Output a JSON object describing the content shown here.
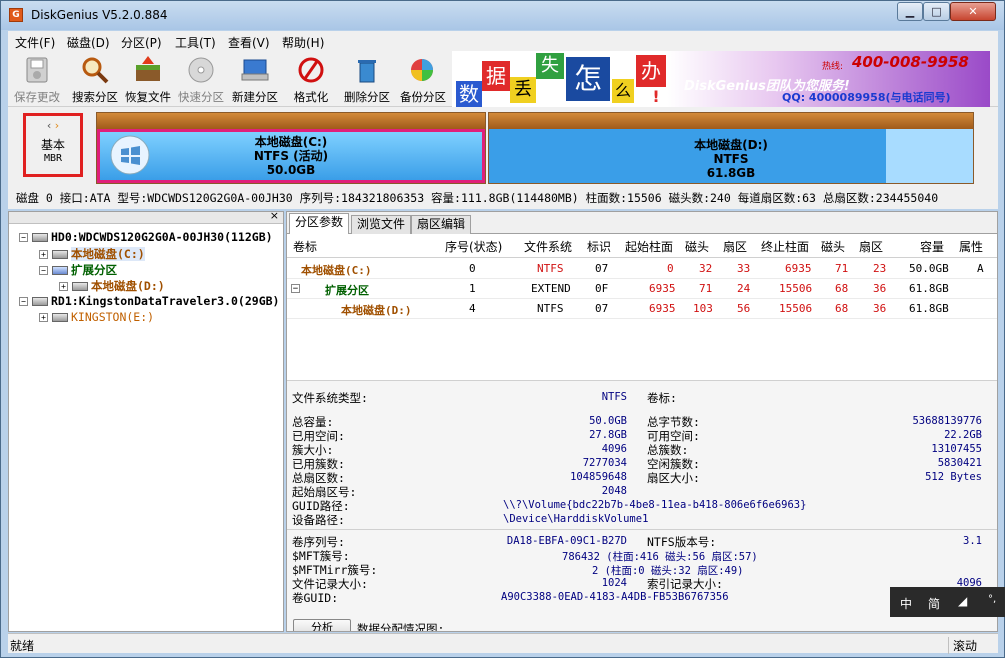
{
  "window": {
    "title": "DiskGenius V5.2.0.884",
    "app_icon": "G"
  },
  "window_buttons": {
    "minimize": "▁",
    "maximize": "□",
    "close": "✕"
  },
  "menu": [
    "文件(F)",
    "磁盘(D)",
    "分区(P)",
    "工具(T)",
    "查看(V)",
    "帮助(H)"
  ],
  "toolbar": [
    {
      "label": "保存更改",
      "icon": "save-icon",
      "enabled": false
    },
    {
      "label": "搜索分区",
      "icon": "magnifier-icon",
      "enabled": true
    },
    {
      "label": "恢复文件",
      "icon": "recover-files-icon",
      "enabled": true
    },
    {
      "label": "快速分区",
      "icon": "quick-partition-icon",
      "enabled": false
    },
    {
      "label": "新建分区",
      "icon": "new-partition-icon",
      "enabled": true
    },
    {
      "label": "格式化",
      "icon": "format-icon",
      "enabled": true
    },
    {
      "label": "删除分区",
      "icon": "delete-partition-icon",
      "enabled": true
    },
    {
      "label": "备份分区",
      "icon": "backup-partition-icon",
      "enabled": true
    }
  ],
  "banner": {
    "chars": [
      "数",
      "据",
      "丢",
      "失",
      "怎",
      "么",
      "办",
      "!"
    ],
    "slogan": "DiskGenius团队为您服务!",
    "hotline_label": "热线:",
    "hotline": "400-008-9958",
    "qq": "QQ: 4000089958(与电话同号)"
  },
  "disk_map": {
    "type_label": "基本",
    "type_sub": "MBR",
    "partitions": [
      {
        "name": "本地磁盘(C:)",
        "fs": "NTFS (活动)",
        "size": "50.0GB"
      },
      {
        "name": "本地磁盘(D:)",
        "fs": "NTFS",
        "size": "61.8GB"
      }
    ]
  },
  "disk_info": "磁盘 0 接口:ATA  型号:WDCWDS120G2G0A-00JH30  序列号:184321806353  容量:111.8GB(114480MB)  柱面数:15506  磁头数:240  每道扇区数:63  总扇区数:234455040",
  "tree": [
    {
      "label": "HD0:WDCWDS120G2G0A-00JH30(112GB)",
      "toggle": "−"
    },
    {
      "label": "本地磁盘(C:)",
      "toggle": "+"
    },
    {
      "label": "扩展分区",
      "toggle": "−"
    },
    {
      "label": "本地磁盘(D:)",
      "toggle": "+"
    },
    {
      "label": "RD1:KingstonDataTraveler3.0(29GB)",
      "toggle": "−"
    },
    {
      "label": "KINGSTON(E:)",
      "toggle": "+"
    }
  ],
  "tabs": [
    "分区参数",
    "浏览文件",
    "扇区编辑"
  ],
  "table": {
    "headers": [
      "卷标",
      "序号(状态)",
      "文件系统",
      "标识",
      "起始柱面",
      "磁头",
      "扇区",
      "终止柱面",
      "磁头",
      "扇区",
      "容量",
      "属性"
    ],
    "rows": [
      [
        "本地磁盘(C:)",
        "0",
        "NTFS",
        "07",
        "0",
        "32",
        "33",
        "6935",
        "71",
        "23",
        "50.0GB",
        "A"
      ],
      [
        "扩展分区",
        "1",
        "EXTEND",
        "0F",
        "6935",
        "71",
        "24",
        "15506",
        "68",
        "36",
        "61.8GB",
        ""
      ],
      [
        "本地磁盘(D:)",
        "4",
        "NTFS",
        "07",
        "6935",
        "103",
        "56",
        "15506",
        "68",
        "36",
        "61.8GB",
        ""
      ]
    ]
  },
  "details": {
    "fs_type_label": "文件系统类型:",
    "fs_type": "NTFS",
    "vol_label": "卷标:",
    "total_label": "总容量:",
    "total": "50.0GB",
    "total_bytes_label": "总字节数:",
    "total_bytes": "53688139776",
    "used_label": "已用空间:",
    "used": "27.8GB",
    "free_label": "可用空间:",
    "free": "22.2GB",
    "cluster_size_label": "簇大小:",
    "cluster_size": "4096",
    "total_clusters_label": "总簇数:",
    "total_clusters": "13107455",
    "used_clusters_label": "已用簇数:",
    "used_clusters": "7277034",
    "free_clusters_label": "空闲簇数:",
    "free_clusters": "5830421",
    "total_sectors_label": "总扇区数:",
    "total_sectors": "104859648",
    "sector_size_label": "扇区大小:",
    "sector_size": "512 Bytes",
    "start_sector_label": "起始扇区号:",
    "start_sector": "2048",
    "guid_path_label": "GUID路径:",
    "guid_path": "\\\\?\\Volume{bdc22b7b-4be8-11ea-b418-806e6f6e6963}",
    "device_path_label": "设备路径:",
    "device_path": "\\Device\\HarddiskVolume1",
    "serial_label": "卷序列号:",
    "serial": "DA18-EBFA-09C1-B27D",
    "ntfs_ver_label": "NTFS版本号:",
    "ntfs_ver": "3.1",
    "mft_label": "$MFT簇号:",
    "mft": "786432 (柱面:416 磁头:56 扇区:57)",
    "mftmirr_label": "$MFTMirr簇号:",
    "mftmirr": "2 (柱面:0 磁头:32 扇区:49)",
    "frs_label": "文件记录大小:",
    "frs": "1024",
    "irs_label": "索引记录大小:",
    "irs": "4096",
    "vol_guid_label": "卷GUID:",
    "vol_guid": "A90C3388-0EAD-4183-A4DB-FB53B6767356",
    "analyze_btn": "分析",
    "allocation_label": "数据分配情况图:"
  },
  "status": {
    "left": "就绪",
    "right": "滚动"
  },
  "ime": {
    "mode": "中",
    "variant": "简",
    "extra": "°,"
  },
  "colors": {
    "title_bg": "#a9c6e6",
    "partition_fill": "#3a9ee8",
    "partition_top": "#a05a1a",
    "selected_border": "#e0207a",
    "value_text": "#000080"
  }
}
